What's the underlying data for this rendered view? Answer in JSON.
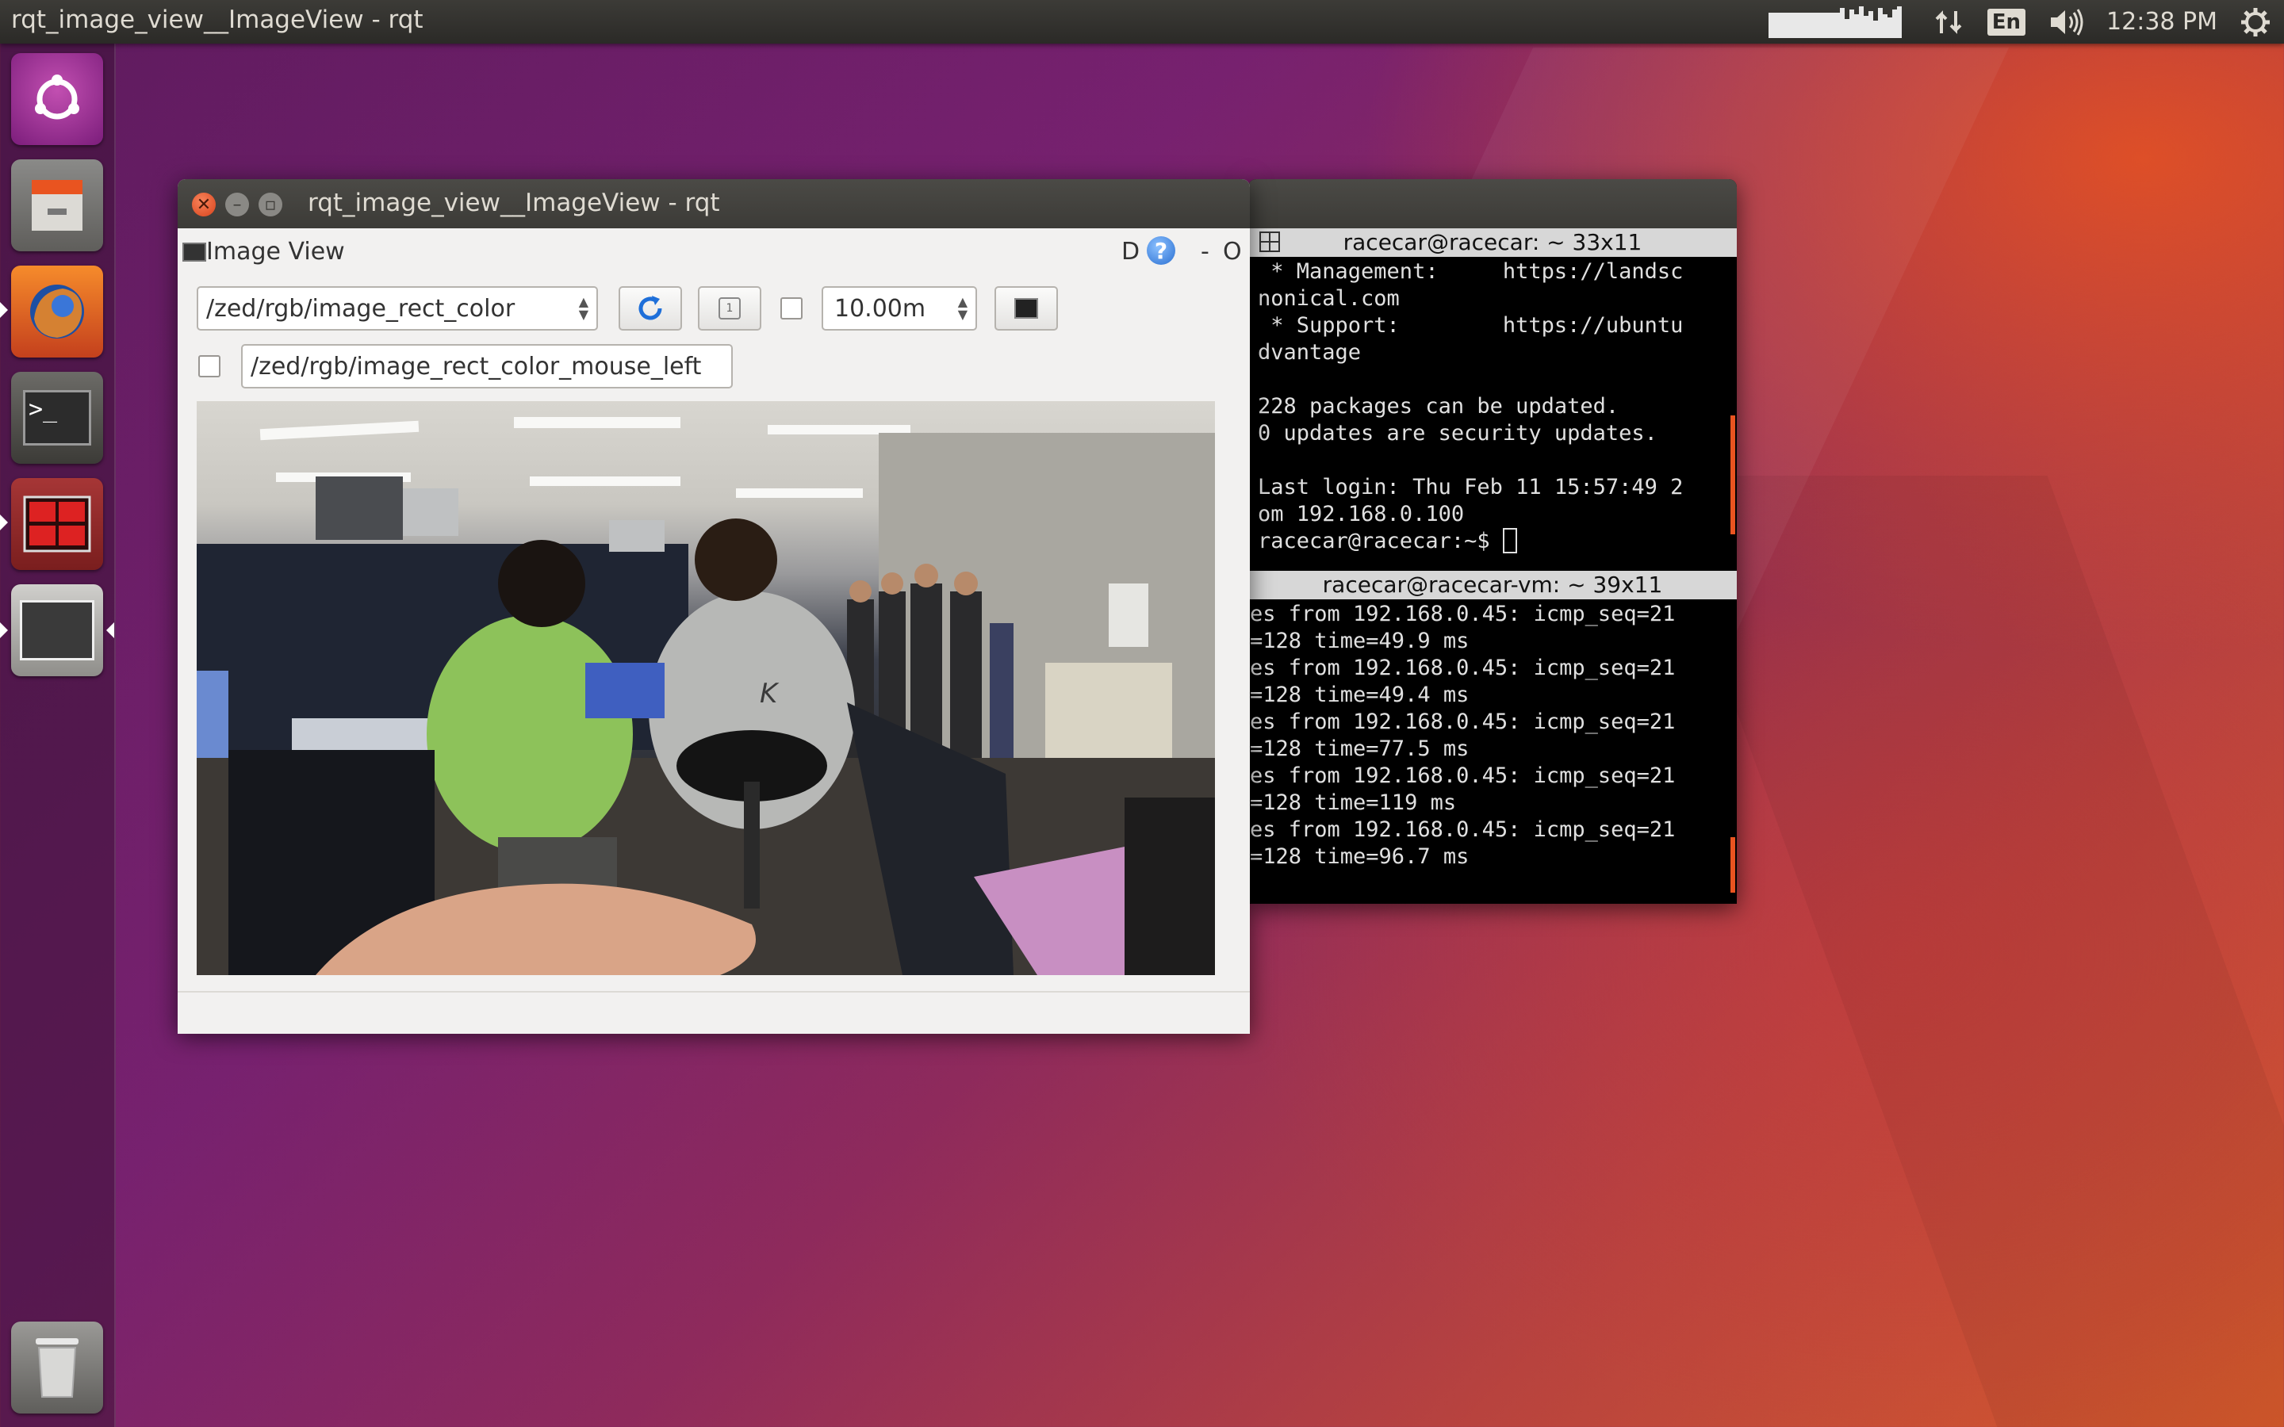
{
  "panel": {
    "title": "rqt_image_view__ImageView - rqt",
    "lang": "En",
    "clock": "12:38 PM"
  },
  "launcher": {
    "items": [
      {
        "name": "ubuntu-dash-icon"
      },
      {
        "name": "files-icon"
      },
      {
        "name": "firefox-icon"
      },
      {
        "name": "terminal-icon"
      },
      {
        "name": "terminator-icon"
      },
      {
        "name": "workspace-icon"
      },
      {
        "name": "trash-icon"
      }
    ]
  },
  "rqt": {
    "window_title": "rqt_image_view__ImageView - rqt",
    "plugin_title": "Image View",
    "plugin_d": "D",
    "plugin_help": "?",
    "plugin_min": "-",
    "plugin_close": "O",
    "topic": "/zed/rgb/image_rect_color",
    "timeout": "10.00m",
    "mouse_topic": "/zed/rgb/image_rect_color_mouse_left"
  },
  "terminal": {
    "pane1_title": "racecar@racecar: ~ 33x11",
    "pane1_lines": [
      " * Management:     https://landsc",
      "nonical.com",
      " * Support:        https://ubuntu",
      "dvantage",
      "",
      "228 packages can be updated.",
      "0 updates are security updates.",
      "",
      "Last login: Thu Feb 11 15:57:49 2",
      "om 192.168.0.100",
      "racecar@racecar:~$ "
    ],
    "pane2_title": "racecar@racecar-vm: ~ 39x11",
    "pane2_lines": [
      "es from 192.168.0.45: icmp_seq=21",
      "=128 time=49.9 ms",
      "es from 192.168.0.45: icmp_seq=21",
      "=128 time=49.4 ms",
      "es from 192.168.0.45: icmp_seq=21",
      "=128 time=77.5 ms",
      "es from 192.168.0.45: icmp_seq=21",
      "=128 time=119 ms",
      "es from 192.168.0.45: icmp_seq=21",
      "=128 time=96.7 ms"
    ]
  },
  "colors": {
    "ubuntu_orange": "#e95420",
    "panel_bg": "#3c3b37",
    "window_bg": "#f2f1f0"
  }
}
